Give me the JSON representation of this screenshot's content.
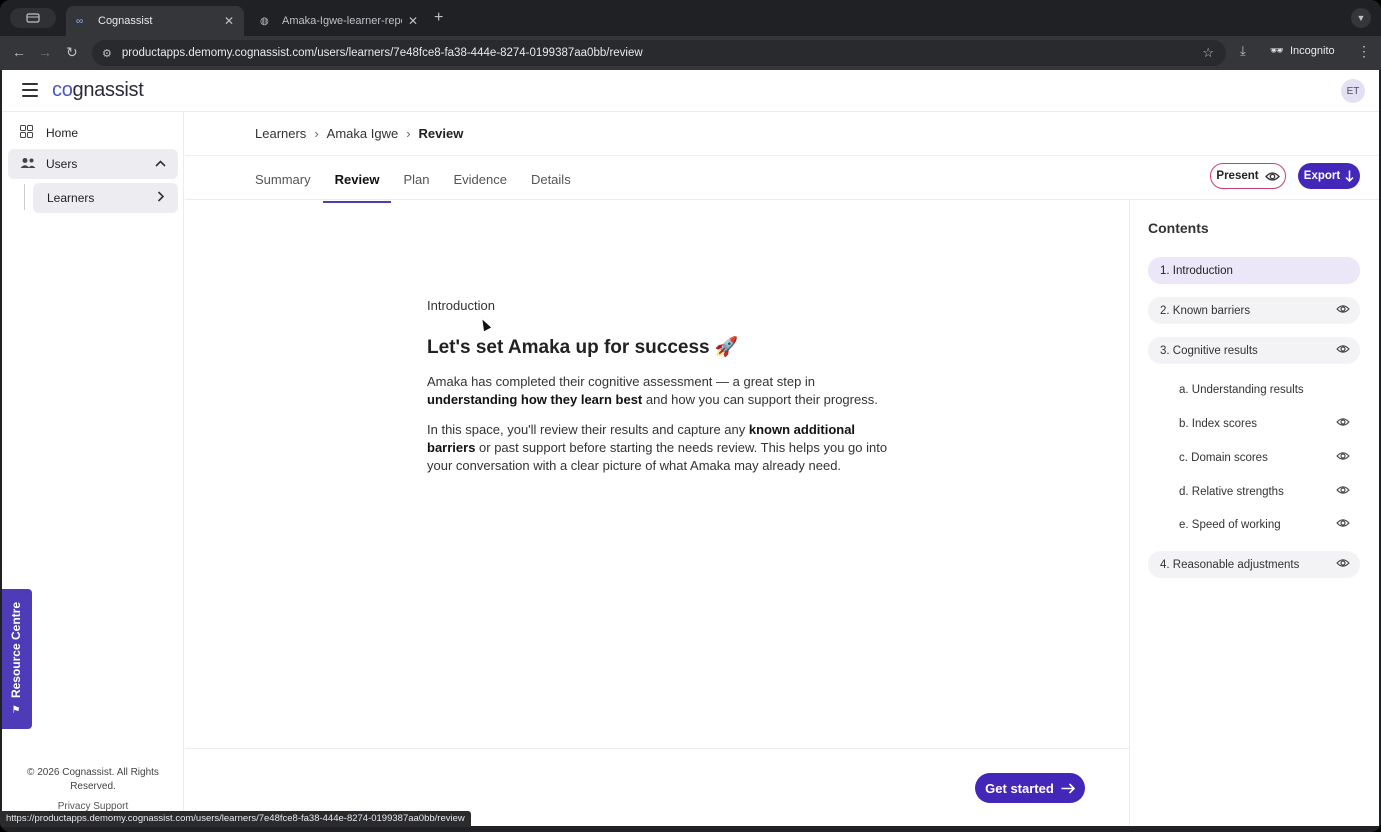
{
  "browser": {
    "tabs": [
      {
        "title": "Cognassist",
        "active": true
      },
      {
        "title": "Amaka-Igwe-learner-report.p",
        "active": false
      }
    ],
    "url": "productapps.demomy.cognassist.com/users/learners/7e48fce8-fa38-444e-8274-0199387aa0bb/review",
    "mode_label": "Incognito",
    "status_url": "https://productapps.demomy.cognassist.com/users/learners/7e48fce8-fa38-444e-8274-0199387aa0bb/review"
  },
  "app": {
    "logo_prefix": "co",
    "logo_rest": "gnassist",
    "avatar_initials": "ET"
  },
  "sidebar": {
    "home": "Home",
    "users": "Users",
    "learners": "Learners",
    "copyright": "© 2026 Cognassist. All Rights Reserved.",
    "footer_links": "Privacy   Support",
    "resource_centre": "Resource Centre"
  },
  "breadcrumb": [
    "Learners",
    "Amaka Igwe",
    "Review"
  ],
  "tabs": [
    "Summary",
    "Review",
    "Plan",
    "Evidence",
    "Details"
  ],
  "actions": {
    "present": "Present",
    "export": "Export",
    "get_started": "Get started"
  },
  "content": {
    "eyebrow": "Introduction",
    "headline": "Let's set Amaka up for success 🚀",
    "p1_a": "Amaka has completed their cognitive assessment — a great step in ",
    "p1_b": "understanding how they learn best",
    "p1_c": " and how you can support their progress.",
    "p2_a": "In this space, you'll review their results and capture any ",
    "p2_b": "known additional barriers",
    "p2_c": " or past support before starting the needs review. This helps you go into your conversation with a clear picture of what Amaka may already need."
  },
  "contents": {
    "title": "Contents",
    "items": [
      {
        "label": "1. Introduction"
      },
      {
        "label": "2. Known barriers"
      },
      {
        "label": "3. Cognitive results"
      },
      {
        "label": "a. Understanding results"
      },
      {
        "label": "b. Index scores"
      },
      {
        "label": "c. Domain scores"
      },
      {
        "label": "d. Relative strengths"
      },
      {
        "label": "e. Speed of working"
      },
      {
        "label": "4. Reasonable adjustments"
      }
    ]
  },
  "colors": {
    "brand": "#4227b8",
    "accent_pink": "#c7406b",
    "active_toc": "#ebe6f8"
  }
}
